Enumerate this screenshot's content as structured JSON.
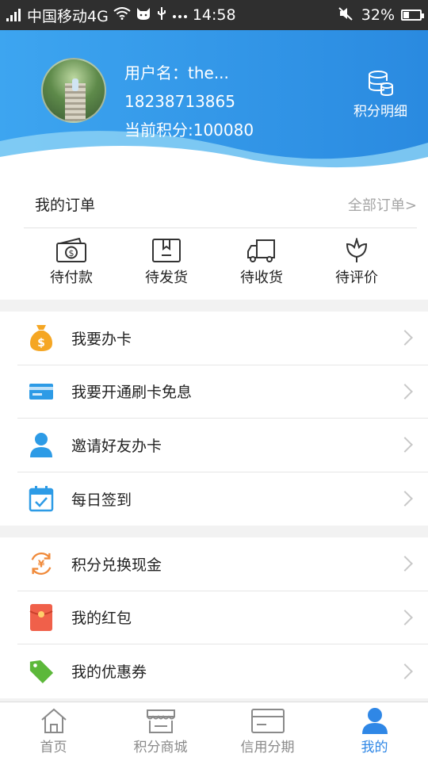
{
  "status_bar": {
    "carrier": "中国移动4G",
    "time": "14:58",
    "battery": "32%"
  },
  "header": {
    "username_line": "用户名：the...",
    "phone": "18238713865",
    "points_line": "当前积分:100080",
    "points_detail_label": "积分明细"
  },
  "orders": {
    "title": "我的订单",
    "all_link": "全部订单>",
    "items": [
      {
        "label": "待付款",
        "icon": "money-icon"
      },
      {
        "label": "待发货",
        "icon": "box-icon"
      },
      {
        "label": "待收货",
        "icon": "truck-icon"
      },
      {
        "label": "待评价",
        "icon": "flower-icon"
      }
    ]
  },
  "menu_group_1": [
    {
      "label": "我要办卡",
      "icon": "money-bag-icon"
    },
    {
      "label": "我要开通刷卡免息",
      "icon": "card-icon"
    },
    {
      "label": "邀请好友办卡",
      "icon": "person-icon"
    },
    {
      "label": "每日签到",
      "icon": "calendar-check-icon"
    }
  ],
  "menu_group_2": [
    {
      "label": "积分兑换现金",
      "icon": "yuan-exchange-icon"
    },
    {
      "label": "我的红包",
      "icon": "red-envelope-icon"
    },
    {
      "label": "我的优惠券",
      "icon": "tag-icon"
    }
  ],
  "tabs": [
    {
      "label": "首页",
      "icon": "home-icon"
    },
    {
      "label": "积分商城",
      "icon": "shop-icon"
    },
    {
      "label": "信用分期",
      "icon": "credit-card-icon"
    },
    {
      "label": "我的",
      "icon": "user-icon",
      "active": true
    }
  ],
  "colors": {
    "brand_blue": "#2f87e6",
    "header_gradient_start": "#3da5f0",
    "header_gradient_end": "#2a8ae0",
    "inactive_tab": "#8a8a8a"
  }
}
